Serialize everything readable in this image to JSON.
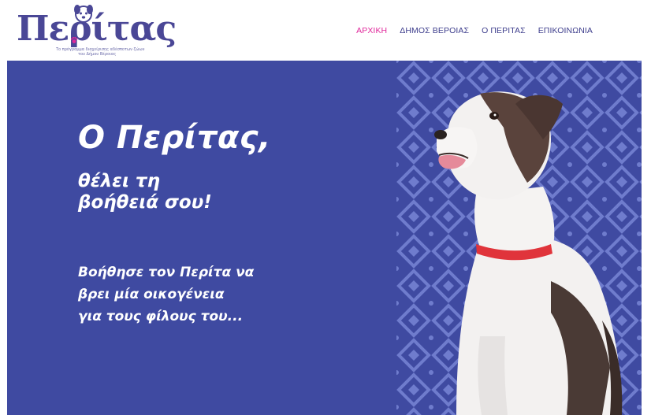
{
  "header": {
    "logo": {
      "name": "Περίτας",
      "tagline_line1": "Το πρόγραμμα διαχείρισης αδέσποτων ζώων",
      "tagline_line2": "του Δήμου Βέροιας"
    },
    "nav": [
      {
        "label": "ΑΡΧΙΚΗ",
        "active": true
      },
      {
        "label": "ΔΗΜΟΣ ΒΕΡΟΙΑΣ",
        "active": false
      },
      {
        "label": "Ο ΠΕΡΙΤΑΣ",
        "active": false
      },
      {
        "label": "ΕΠΙΚΟΙΝΩΝΙΑ",
        "active": false
      }
    ]
  },
  "hero": {
    "title": "Ο Περίτας,",
    "subtitle_line1": "θέλει τη",
    "subtitle_line2": "βοήθειά σου!",
    "body_line1": "Βοήθησε τον Περίτα να",
    "body_line2": "βρει μία οικογένεια",
    "body_line3": "για τους φίλους του..."
  },
  "colors": {
    "hero_bg": "#3f4aa1",
    "pattern": "#6f7ccd",
    "nav_active": "#e0289b",
    "nav_text": "#3d3d8c",
    "logo": "#4a4796",
    "collar": "#e0343b"
  },
  "icons": [
    "dog-logo-icon",
    "paw-icon"
  ]
}
